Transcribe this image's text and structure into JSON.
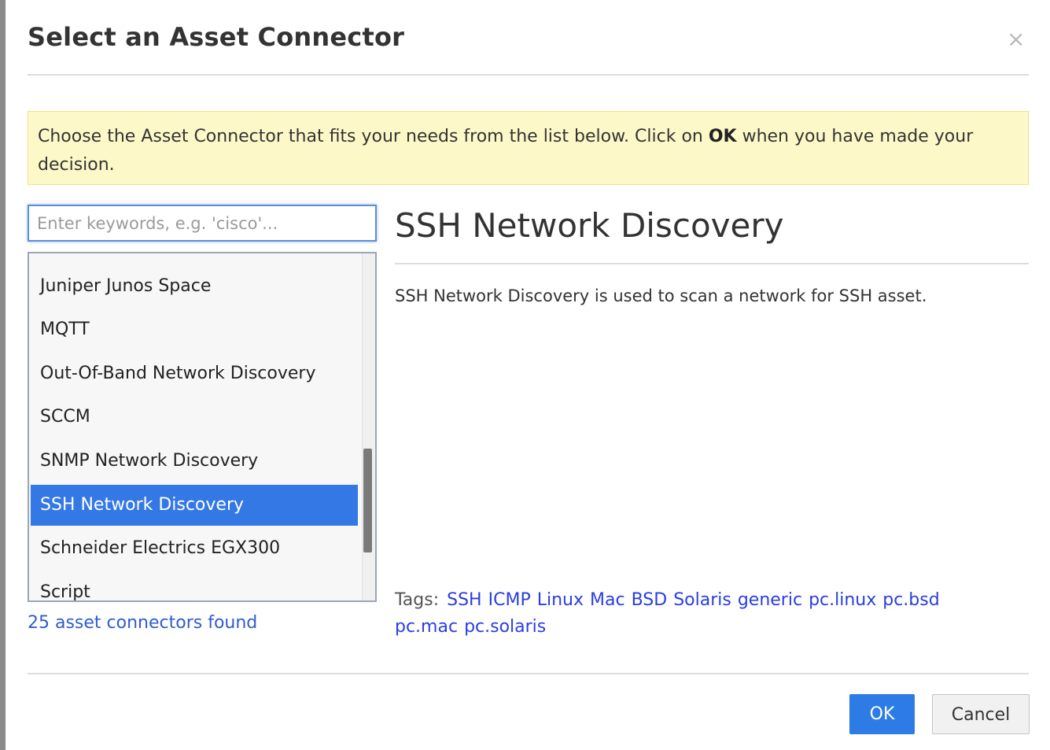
{
  "dialog": {
    "title": "Select an Asset Connector",
    "close_label": "×"
  },
  "info": {
    "text_before": "Choose the Asset Connector that fits your needs from the list below. Click on ",
    "bold": "OK",
    "text_after": " when you have made your decision."
  },
  "search": {
    "placeholder": "Enter keywords, e.g. 'cisco'...",
    "value": ""
  },
  "list": {
    "items": [
      "Juniper Junos Space",
      "MQTT",
      "Out-Of-Band Network Discovery",
      "SCCM",
      "SNMP Network Discovery",
      "SSH Network Discovery",
      "Schneider Electrics EGX300",
      "Script"
    ],
    "selected": "SSH Network Discovery",
    "found_text": "25 asset connectors found"
  },
  "detail": {
    "title": "SSH Network Discovery",
    "description": "SSH Network Discovery is used to scan a network for SSH asset.",
    "tags_label": "Tags:",
    "tags": [
      "SSH",
      "ICMP",
      "Linux",
      "Mac",
      "BSD",
      "Solaris",
      "generic",
      "pc.linux",
      "pc.bsd",
      "pc.mac",
      "pc.solaris"
    ]
  },
  "buttons": {
    "ok": "OK",
    "cancel": "Cancel"
  }
}
